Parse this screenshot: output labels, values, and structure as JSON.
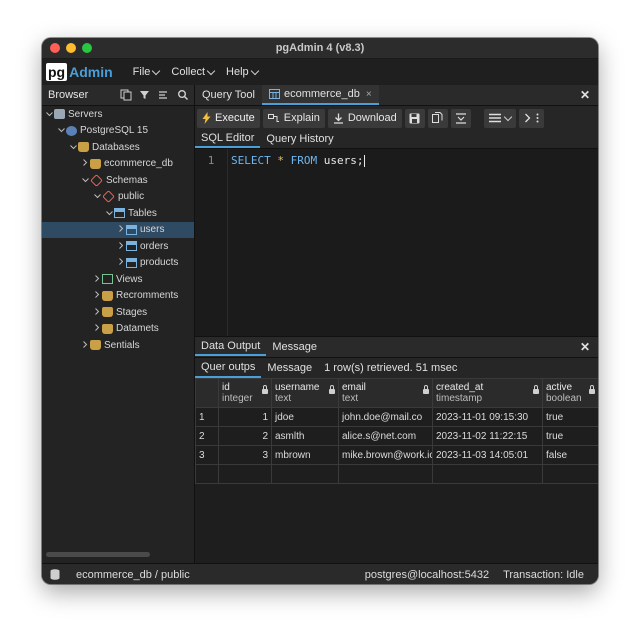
{
  "window": {
    "title": "pgAdmin 4 (v8.3)"
  },
  "colors": {
    "accent": "#4a9fd8",
    "close": "#ff5f57",
    "minimize": "#febc2e",
    "maximize": "#28c840"
  },
  "logo": {
    "pg": "pg",
    "admin": "Admin"
  },
  "menu": [
    {
      "label": "File"
    },
    {
      "label": "Collect"
    },
    {
      "label": "Help"
    }
  ],
  "browser": {
    "label": "Browser",
    "tools": [
      "object-explorer-icon",
      "filter-icon",
      "properties-icon",
      "search-icon"
    ],
    "tree": [
      {
        "label": "Servers",
        "icon": "server",
        "indent": 0,
        "caret": "v"
      },
      {
        "label": "PostgreSQL 15",
        "icon": "postgres",
        "indent": 1,
        "caret": "v"
      },
      {
        "label": "Databases",
        "icon": "db",
        "indent": 2,
        "caret": "v"
      },
      {
        "label": "ecommerce_db",
        "icon": "db",
        "indent": 3,
        "caret": ">"
      },
      {
        "label": "Schemas",
        "icon": "schema",
        "indent": 3,
        "caret": "v"
      },
      {
        "label": "public",
        "icon": "schema",
        "indent": 4,
        "caret": "v"
      },
      {
        "label": "Tables",
        "icon": "table",
        "indent": 5,
        "caret": "v"
      },
      {
        "label": "users",
        "icon": "table",
        "indent": 6,
        "caret": ">",
        "selected": true
      },
      {
        "label": "orders",
        "icon": "table",
        "indent": 6,
        "caret": ">"
      },
      {
        "label": "products",
        "icon": "table",
        "indent": 6,
        "caret": ">"
      },
      {
        "label": "Views",
        "icon": "view",
        "indent": 4,
        "caret": ">"
      },
      {
        "label": "Recromments",
        "icon": "db",
        "indent": 4,
        "caret": ">"
      },
      {
        "label": "Stages",
        "icon": "db",
        "indent": 4,
        "caret": ">"
      },
      {
        "label": "Datamets",
        "icon": "db",
        "indent": 4,
        "caret": ">"
      },
      {
        "label": "Sentials",
        "icon": "db",
        "indent": 3,
        "caret": ">"
      }
    ]
  },
  "tabs": [
    {
      "label": "Query Tool"
    },
    {
      "label": "ecommerce_db",
      "closable": "×"
    }
  ],
  "close_glyph": "✕",
  "toolbar": {
    "execute": "Execute",
    "explain": "Explain",
    "download": "Download"
  },
  "subtabs": [
    "SQL Editor",
    "Query History"
  ],
  "editor": {
    "line": "1",
    "sql_kw1": "SELECT",
    "sql_star": "*",
    "sql_kw2": "FROM",
    "sql_rest": "users;"
  },
  "results": {
    "tabs": [
      "Data Output",
      "Message"
    ],
    "subtabs": [
      "Quer outps",
      "Message"
    ],
    "info": "1 row(s) retrieved. 51 msec",
    "columns": [
      {
        "name": "id",
        "type": "integer"
      },
      {
        "name": "username",
        "type": "text"
      },
      {
        "name": "email",
        "type": "text"
      },
      {
        "name": "created_at",
        "type": "timestamp"
      },
      {
        "name": "active",
        "type": "boolean"
      }
    ],
    "rows": [
      {
        "n": "1",
        "cells": [
          "1",
          "jdoe",
          "john.doe@mail.co",
          "2023-11-01 09:15:30",
          "true"
        ]
      },
      {
        "n": "2",
        "cells": [
          "2",
          "asmlth",
          "alice.s@net.com",
          "2023-11-02 11:22:15",
          "true"
        ]
      },
      {
        "n": "3",
        "cells": [
          "3",
          "mbrown",
          "mike.brown@work.ic",
          "2023-11-03 14:05:01",
          "false"
        ]
      }
    ]
  },
  "status": {
    "context": "ecommerce_db / public",
    "connection": "postgres@localhost:5432",
    "transaction": "Transaction: Idle"
  }
}
